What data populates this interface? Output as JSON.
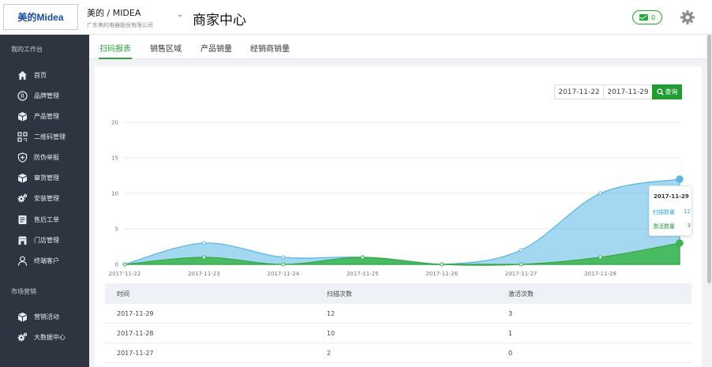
{
  "header": {
    "logo": "美的Midea",
    "brand_name": "美的 / MIDEA",
    "brand_sub": "广东美的电器股份有限公司",
    "center_title": "商家中心",
    "message_count": "0"
  },
  "sidebar": {
    "section1": "我的工作台",
    "section2": "市场营销",
    "items": [
      {
        "label": "首页",
        "icon": "home-icon"
      },
      {
        "label": "品牌管理",
        "icon": "registered-icon"
      },
      {
        "label": "产品管理",
        "icon": "box-icon"
      },
      {
        "label": "二维码管理",
        "icon": "qrcode-icon"
      },
      {
        "label": "防伪举报",
        "icon": "shield-icon"
      },
      {
        "label": "窜货管理",
        "icon": "box-icon"
      },
      {
        "label": "安装管理",
        "icon": "gears-icon"
      },
      {
        "label": "售后工单",
        "icon": "ticket-icon"
      },
      {
        "label": "门店管理",
        "icon": "store-icon"
      },
      {
        "label": "终端客户",
        "icon": "user-icon"
      }
    ],
    "items2": [
      {
        "label": "营销活动",
        "icon": "box-icon"
      },
      {
        "label": "大数据中心",
        "icon": "gears-icon"
      }
    ]
  },
  "tabs": [
    "扫码报表",
    "销售区域",
    "产品销量",
    "经销商销量"
  ],
  "filter": {
    "start_date": "2017-11-22",
    "end_date": "2017-11-29",
    "query_label": "查询"
  },
  "colors": {
    "accent": "#2aa53a",
    "scan_series": "#5ab8e6",
    "activate_series": "#3bb54a"
  },
  "chart_data": {
    "type": "area",
    "x": [
      "2017-11-22",
      "2017-11-23",
      "2017-11-24",
      "2017-11-25",
      "2017-11-26",
      "2017-11-27",
      "2017-11-28",
      "2017-11-29"
    ],
    "x_tick_labels": [
      "2017-11-22",
      "2017-11-23",
      "2017-11-24",
      "2017-11-25",
      "2017-11-26",
      "2017-11-27",
      "2017-11-28"
    ],
    "series": [
      {
        "name": "扫描数量",
        "values": [
          0,
          3,
          1,
          1,
          0,
          2,
          10,
          12
        ]
      },
      {
        "name": "激活数量",
        "values": [
          0,
          1,
          0,
          1,
          0,
          0,
          1,
          3
        ]
      }
    ],
    "y_ticks": [
      0,
      5,
      10,
      15,
      20
    ],
    "ylim": [
      0,
      20
    ],
    "grid": true,
    "tooltip": {
      "title": "2017-11-29",
      "rows": [
        {
          "label": "扫描数量",
          "value": "12"
        },
        {
          "label": "激活数量",
          "value": "3"
        }
      ]
    }
  },
  "table": {
    "headers": [
      "时间",
      "扫描次数",
      "激活次数"
    ],
    "rows": [
      [
        "2017-11-29",
        "12",
        "3"
      ],
      [
        "2017-11-28",
        "10",
        "1"
      ],
      [
        "2017-11-27",
        "2",
        "0"
      ]
    ]
  }
}
